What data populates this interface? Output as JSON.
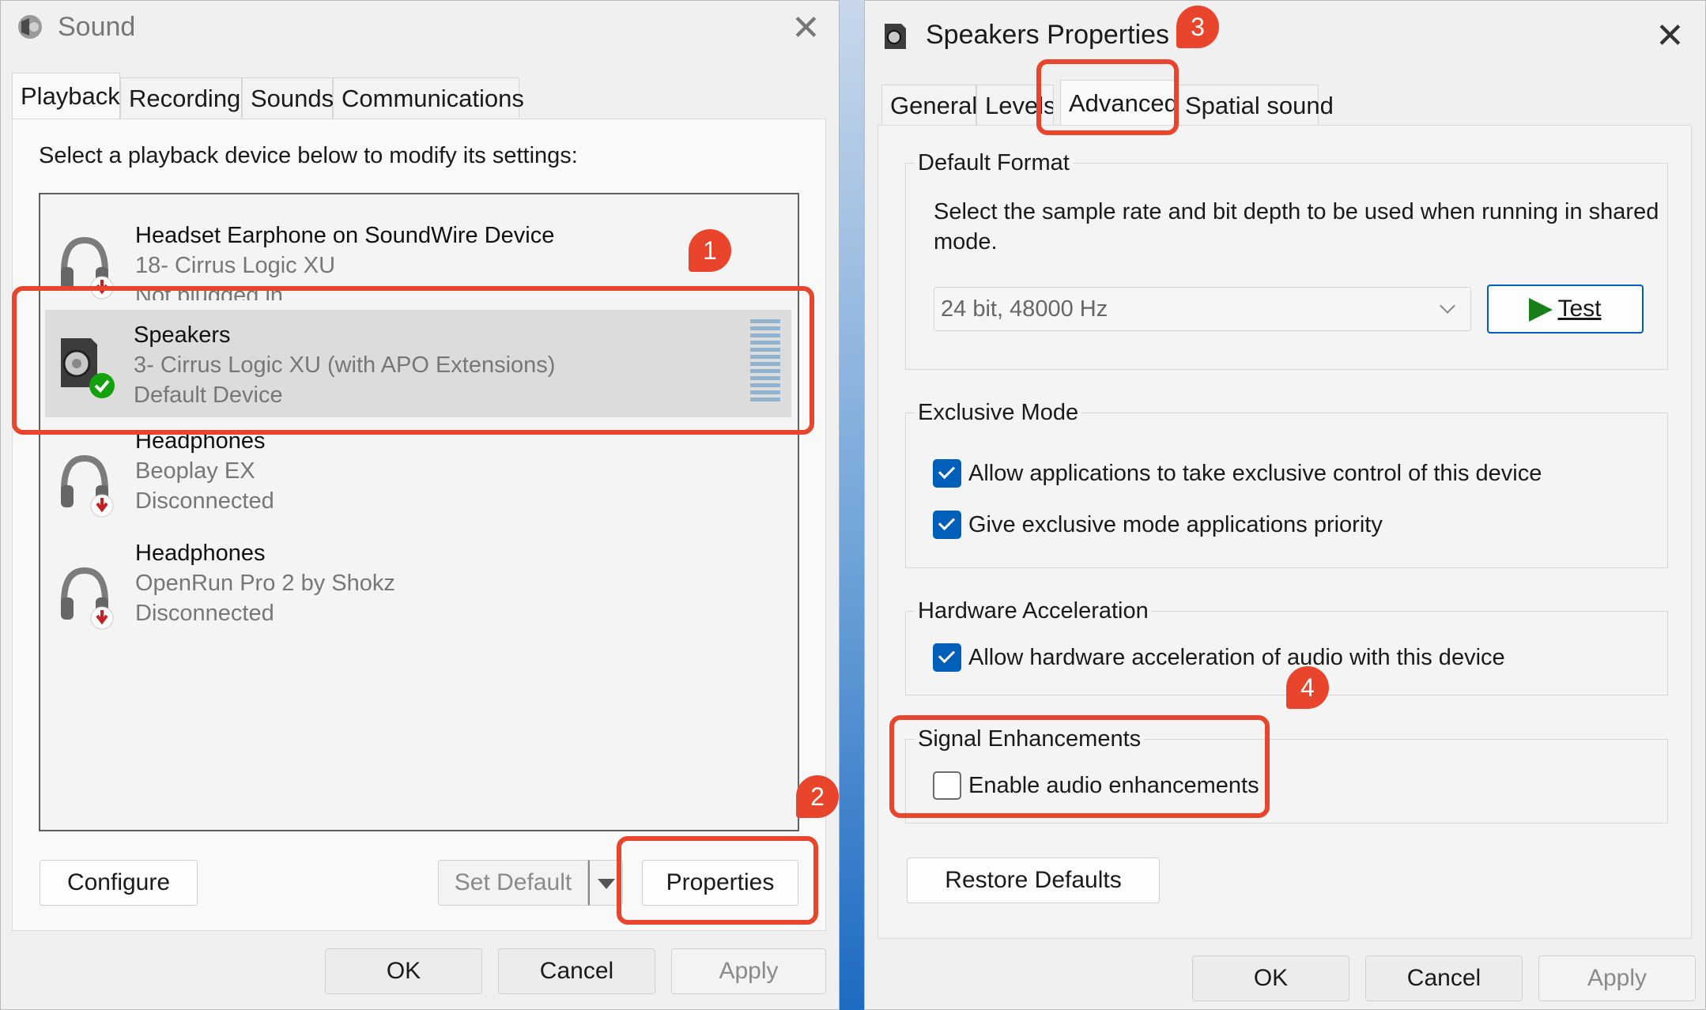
{
  "sound": {
    "title": "Sound",
    "tabs": [
      "Playback",
      "Recording",
      "Sounds",
      "Communications"
    ],
    "instruction": "Select a playback device below to modify its settings:",
    "devices": [
      {
        "name": "Headset Earphone on SoundWire Device",
        "sub": "18- Cirrus Logic XU",
        "status": "Not plugged in",
        "icon": "headset-icon"
      },
      {
        "name": "Speakers",
        "sub": "3- Cirrus Logic XU (with APO Extensions)",
        "status": "Default Device",
        "icon": "speaker-icon"
      },
      {
        "name": "Headphones",
        "sub": "Beoplay EX",
        "status": "Disconnected",
        "icon": "headphones-icon"
      },
      {
        "name": "Headphones",
        "sub": "OpenRun Pro 2 by Shokz",
        "status": "Disconnected",
        "icon": "headphones-icon"
      }
    ],
    "buttons": {
      "configure": "Configure",
      "set_default": "Set Default",
      "properties": "Properties",
      "ok": "OK",
      "cancel": "Cancel",
      "apply": "Apply"
    }
  },
  "props": {
    "title": "Speakers Properties",
    "tabs": [
      "General",
      "Levels",
      "Advanced",
      "Spatial sound"
    ],
    "default_format": {
      "title": "Default Format",
      "description_line1": "Select the sample rate and bit depth to be used when running in shared",
      "description_line2": "mode.",
      "selected": "24 bit, 48000 Hz",
      "test": "Test"
    },
    "exclusive": {
      "title": "Exclusive Mode",
      "opt1": "Allow applications to take exclusive control of this device",
      "opt2": "Give exclusive mode applications priority"
    },
    "hardware": {
      "title": "Hardware Acceleration",
      "opt1": "Allow hardware acceleration of audio with this device"
    },
    "signal": {
      "title": "Signal Enhancements",
      "opt1": "Enable audio enhancements"
    },
    "restore": "Restore Defaults",
    "buttons": {
      "ok": "OK",
      "cancel": "Cancel",
      "apply": "Apply"
    }
  },
  "markers": [
    "1",
    "2",
    "3",
    "4"
  ],
  "colors": {
    "highlight": "#e8452c",
    "accent": "#005fb8",
    "test_play": "#1a7f1a"
  }
}
